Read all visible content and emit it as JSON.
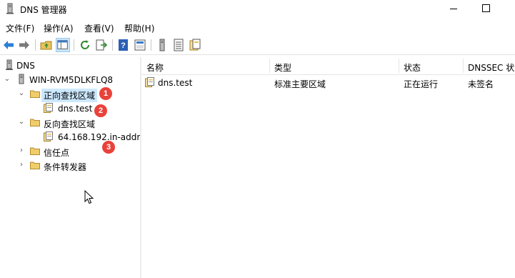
{
  "window": {
    "title": "DNS 管理器",
    "icon": "dns-manager-icon"
  },
  "menu": {
    "items": [
      {
        "label": "文件(F)"
      },
      {
        "label": "操作(A)"
      },
      {
        "label": "查看(V)"
      },
      {
        "label": "帮助(H)"
      }
    ]
  },
  "toolbar": {
    "buttons": [
      "back-icon",
      "forward-icon",
      "up-folder-icon",
      "show-hide-tree-icon",
      "refresh-icon",
      "export-list-icon",
      "help-icon",
      "properties-icon",
      "server-icon",
      "list-icon",
      "zone-icon"
    ]
  },
  "tree": {
    "root": "DNS",
    "server": "WIN-RVM5DLKFLQ8",
    "forward_zones": "正向查找区域",
    "forward_zone_child": "dns.test",
    "reverse_zones": "反向查找区域",
    "reverse_zone_child": "64.168.192.in-addr.",
    "trust_points": "信任点",
    "conditional_forwarders": "条件转发器"
  },
  "badges": {
    "one": "1",
    "two": "2",
    "three": "3"
  },
  "list": {
    "headers": {
      "name": "名称",
      "type": "类型",
      "status": "状态",
      "dnssec": "DNSSEC 状"
    },
    "rows": [
      {
        "name": "dns.test",
        "type": "标准主要区域",
        "status": "正在运行",
        "dnssec": "未签名"
      }
    ]
  },
  "colors": {
    "selection": "#cce8ff",
    "badge": "#e8423a",
    "folder": "#e8c15a"
  }
}
